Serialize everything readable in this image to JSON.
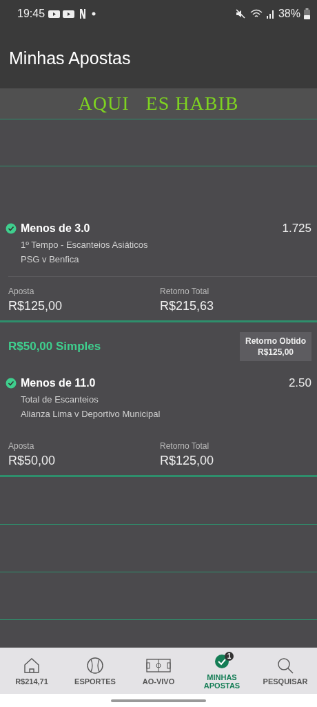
{
  "status_bar": {
    "time": "19:45",
    "battery": "38%"
  },
  "header": {
    "title": "Minhas Apostas"
  },
  "banner": {
    "text": "AQUI   ES HABIB"
  },
  "bets": [
    {
      "selection": "Menos de 3.0",
      "odds": "1.725",
      "market": "1º Tempo - Escanteios Asiáticos",
      "match": "PSG v Benfica",
      "won": true,
      "stake_label": "Aposta",
      "stake": "R$125,00",
      "return_label": "Retorno Total",
      "return": "R$215,63"
    },
    {
      "header": "R$50,00 Simples",
      "result_label": "Retorno Obtido",
      "result_value": "R$125,00",
      "selection": "Menos de 11.0",
      "odds": "2.50",
      "market": "Total de Escanteios",
      "match": "Alianza Lima v Deportivo Municipal",
      "won": true,
      "stake_label": "Aposta",
      "stake": "R$50,00",
      "return_label": "Retorno Total",
      "return": "R$125,00"
    }
  ],
  "nav": [
    {
      "kind": "home",
      "label": "R$214,71",
      "selected": false
    },
    {
      "kind": "sports",
      "label": "ESPORTES",
      "selected": false
    },
    {
      "kind": "live",
      "label": "AO-VIVO",
      "selected": false
    },
    {
      "kind": "bets",
      "label": "MINHAS APOSTAS",
      "selected": true,
      "badge": "1"
    },
    {
      "kind": "search",
      "label": "PESQUISAR",
      "selected": false
    }
  ]
}
